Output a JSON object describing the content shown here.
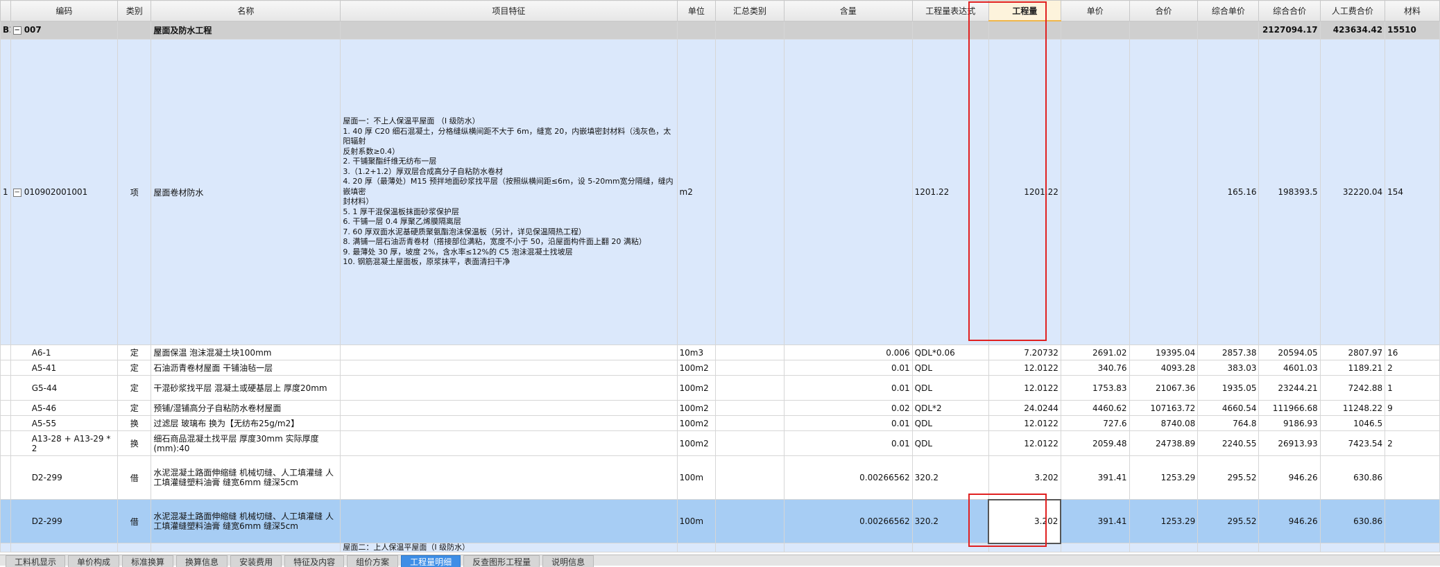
{
  "columns": [
    "编码",
    "类别",
    "名称",
    "项目特征",
    "单位",
    "汇总类别",
    "含量",
    "工程量表达式",
    "工程量",
    "单价",
    "合价",
    "综合单价",
    "综合合价",
    "人工费合价",
    "材料"
  ],
  "group_row": {
    "index": "B1",
    "code": "007",
    "name": "屋面及防水工程",
    "total_price": "2127094.17",
    "labor_total": "423634.42",
    "material_total": "15510"
  },
  "main_row": {
    "index": "1",
    "code": "010902001001",
    "type": "项",
    "name": "屋面卷材防水",
    "features": "屋面一：不上人保温平屋面 （I 级防水）\n1. 40 厚 C20 细石混凝土，分格缝纵横间距不大于 6m，缝宽 20，内嵌填密封材料（浅灰色，太阳辐射\n反射系数≥0.4）\n2. 干铺聚酯纤维无纺布一层\n3.（1.2+1.2）厚双层合成高分子自粘防水卷材\n4. 20 厚（最薄处）M15 预拌地面砂浆找平层（按照纵横间距≤6m，设 5-20mm宽分隔缝，缝内嵌填密\n封材料）\n5. 1 厚干混保温板抹面砂浆保护层\n6. 干铺一层 0.4 厚聚乙烯膜隔离层\n7. 60 厚双面水泥基硬质聚氨酯泡沫保温板（另计，详见保温隔热工程）\n8. 满铺一层石油沥青卷材（搭接部位满粘，宽度不小于 50，沿屋面构件面上翻 20 满粘）\n9. 最薄处 30 厚，坡度 2%，含水率≤12%的 C5 泡沫混凝土找坡层\n10. 钢筋混凝土屋面板，原浆抹平，表面清扫干净",
    "unit": "m2",
    "expr": "1201.22",
    "qty": "1201.22",
    "unit_price": "",
    "total": "",
    "comp_price": "165.16",
    "comp_total": "198393.5",
    "labor": "32220.04",
    "material": "154"
  },
  "sub_rows": [
    {
      "code": "A6-1",
      "type": "定",
      "name": "屋面保温 泡沫混凝土块100mm",
      "unit": "10m3",
      "content": "0.006",
      "expr": "QDL*0.06",
      "qty": "7.20732",
      "unit_price": "2691.02",
      "total": "19395.04",
      "comp_price": "2857.38",
      "comp_total": "20594.05",
      "labor": "2807.97",
      "material": "16"
    },
    {
      "code": "A5-41",
      "type": "定",
      "name": "石油沥青卷材屋面 干铺油毡一层",
      "unit": "100m2",
      "content": "0.01",
      "expr": "QDL",
      "qty": "12.0122",
      "unit_price": "340.76",
      "total": "4093.28",
      "comp_price": "383.03",
      "comp_total": "4601.03",
      "labor": "1189.21",
      "material": "2"
    },
    {
      "code": "G5-44",
      "type": "定",
      "name": "干混砂浆找平层 混凝土或硬基层上 厚度20mm",
      "unit": "100m2",
      "content": "0.01",
      "expr": "QDL",
      "qty": "12.0122",
      "unit_price": "1753.83",
      "total": "21067.36",
      "comp_price": "1935.05",
      "comp_total": "23244.21",
      "labor": "7242.88",
      "material": "1"
    },
    {
      "code": "A5-46",
      "type": "定",
      "name": "预铺/湿铺高分子自粘防水卷材屋面",
      "unit": "100m2",
      "content": "0.02",
      "expr": "QDL*2",
      "qty": "24.0244",
      "unit_price": "4460.62",
      "total": "107163.72",
      "comp_price": "4660.54",
      "comp_total": "111966.68",
      "labor": "11248.22",
      "material": "9"
    },
    {
      "code": "A5-55",
      "type": "换",
      "name": "过滤层 玻璃布  换为【无纺布25g/m2】",
      "unit": "100m2",
      "content": "0.01",
      "expr": "QDL",
      "qty": "12.0122",
      "unit_price": "727.6",
      "total": "8740.08",
      "comp_price": "764.8",
      "comp_total": "9186.93",
      "labor": "1046.5",
      "material": ""
    },
    {
      "code": "A13-28 + A13-29 * 2",
      "type": "换",
      "name": "细石商品混凝土找平层 厚度30mm  实际厚度(mm):40",
      "unit": "100m2",
      "content": "0.01",
      "expr": "QDL",
      "qty": "12.0122",
      "unit_price": "2059.48",
      "total": "24738.89",
      "comp_price": "2240.55",
      "comp_total": "26913.93",
      "labor": "7423.54",
      "material": "2"
    },
    {
      "code": "D2-299",
      "type": "借",
      "name": "水泥混凝土路面伸缩缝 机械切缝、人工填灌缝 人工填灌缝塑料油膏 缝宽6mm 缝深5cm",
      "unit": "100m",
      "content": "0.00266562",
      "expr": "320.2",
      "qty": "3.202",
      "unit_price": "391.41",
      "total": "1253.29",
      "comp_price": "295.52",
      "comp_total": "946.26",
      "labor": "630.86",
      "material": ""
    }
  ],
  "selected_row": {
    "code": "D2-299",
    "type": "借",
    "name": "水泥混凝土路面伸缩缝 机械切缝、人工填灌缝 人工填灌缝塑料油膏 缝宽6mm 缝深5cm",
    "unit": "100m",
    "content": "0.00266562",
    "expr": "320.2",
    "qty": "3.202",
    "unit_price": "391.41",
    "total": "1253.29",
    "comp_price": "295.52",
    "comp_total": "946.26",
    "labor": "630.86",
    "material": ""
  },
  "partial_row": {
    "features": "屋面二：上人保温平屋面（I 级防水）"
  },
  "tabs": [
    "工料机显示",
    "单价构成",
    "标准换算",
    "换算信息",
    "安装费用",
    "特征及内容",
    "组价方案",
    "工程量明细",
    "反查图形工程量",
    "说明信息"
  ],
  "active_tab_index": 7
}
